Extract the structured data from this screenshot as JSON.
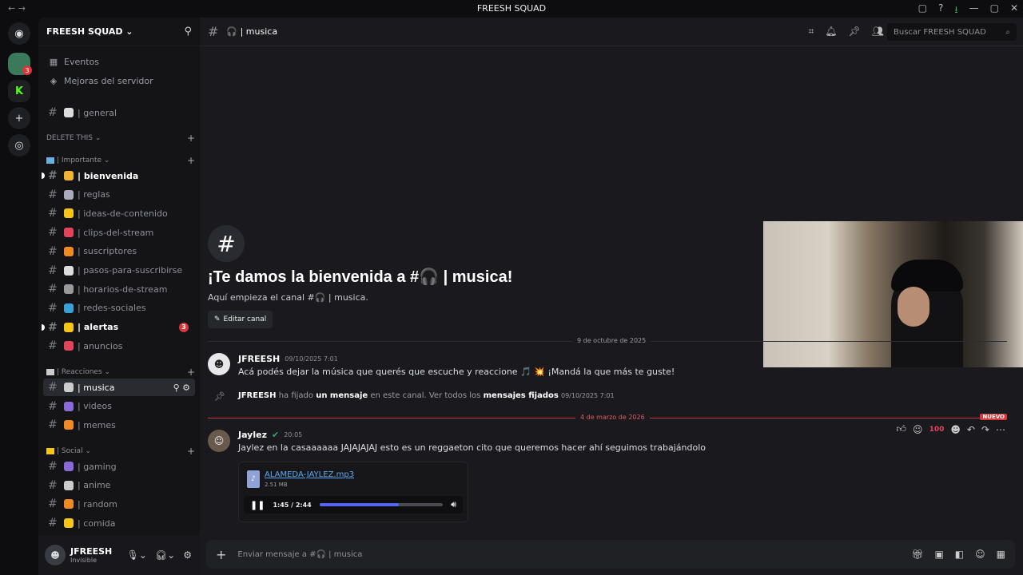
{
  "window": {
    "title": "FREESH SQUAD",
    "nav": "← →",
    "icons": [
      "▢",
      "?",
      "⭳",
      "—",
      "▢",
      "✕"
    ]
  },
  "server": {
    "name": "FREESH SQUAD ⌄",
    "add_icon": "person-add-icon"
  },
  "guilds": {
    "home": "◉",
    "badge": "3",
    "add": "+",
    "explore": "◎"
  },
  "sidebar": {
    "eventos": "Eventos",
    "mejoras": "Mejoras del servidor",
    "general": "| general",
    "cat_delete": "DELETE THIS ⌄",
    "cat_importante": "| Importante ⌄",
    "importante": [
      {
        "label": "| bienvenida",
        "color": "#f0b232",
        "bold": true
      },
      {
        "label": "| reglas",
        "color": "#aab"
      },
      {
        "label": "| ideas-de-contenido",
        "color": "#f5c518"
      },
      {
        "label": "| clips-del-stream",
        "color": "#e2445c"
      },
      {
        "label": "| suscriptores",
        "color": "#f08a24"
      },
      {
        "label": "| pasos-para-suscribirse",
        "color": "#ddd"
      },
      {
        "label": "| horarios-de-stream",
        "color": "#999"
      },
      {
        "label": "| redes-sociales",
        "color": "#3aa0d8"
      },
      {
        "label": "| alertas",
        "color": "#f5c518",
        "bold": true,
        "badge": "3"
      },
      {
        "label": "| anuncios",
        "color": "#e2445c"
      }
    ],
    "cat_reacciones": "| Reacciones ⌄",
    "reacciones": [
      {
        "label": "| musica",
        "color": "#ccc",
        "active": true
      },
      {
        "label": "| videos",
        "color": "#8a6ad8"
      },
      {
        "label": "| memes",
        "color": "#f08a24"
      }
    ],
    "cat_social": "| Social ⌄",
    "social": [
      {
        "label": "| gaming",
        "color": "#8a6ad8"
      },
      {
        "label": "| anime",
        "color": "#ccc"
      },
      {
        "label": "| random",
        "color": "#f08a24"
      },
      {
        "label": "| comida",
        "color": "#f5c518"
      }
    ]
  },
  "user": {
    "name": "JFREESH",
    "status": "Invisible"
  },
  "channel": {
    "name": "🎧 | musica",
    "search_placeholder": "Buscar FREESH SQUAD"
  },
  "welcome": {
    "title": "¡Te damos la bienvenida a #🎧 | musica!",
    "sub": "Aquí empieza el canal #🎧 | musica.",
    "edit": "Editar canal"
  },
  "messages": {
    "date1": "9 de octubre de 2025",
    "m1": {
      "author": "JFREESH",
      "ts": "09/10/2025 7:01",
      "text": "Acá podés dejar la música que querés que escuche y reaccione 🎵 💥 ¡Mandá la que más te guste!"
    },
    "sys": {
      "author": "JFREESH",
      "t1": "ha fijado",
      "t2": "un mensaje",
      "t3": "en este canal. Ver todos los",
      "t4": "mensajes fijados",
      "ts": "09/10/2025 7:01"
    },
    "date2": "4 de marzo de 2026",
    "new": "NUEVO",
    "m2": {
      "author": "Jaylez",
      "ts": "20:05",
      "text": "Jaylez en la casaaaaaa JAJAJAJAJ esto es un reggaeton cito que queremos hacer ahí seguimos trabajándolo"
    },
    "attachment": {
      "name": "ALAMEDA-JAYLEZ.mp3",
      "size": "2.51 MB",
      "time": "1:45 / 2:44",
      "progress": 0.64
    }
  },
  "composer": {
    "placeholder": "Enviar mensaje a #🎧 | musica"
  }
}
